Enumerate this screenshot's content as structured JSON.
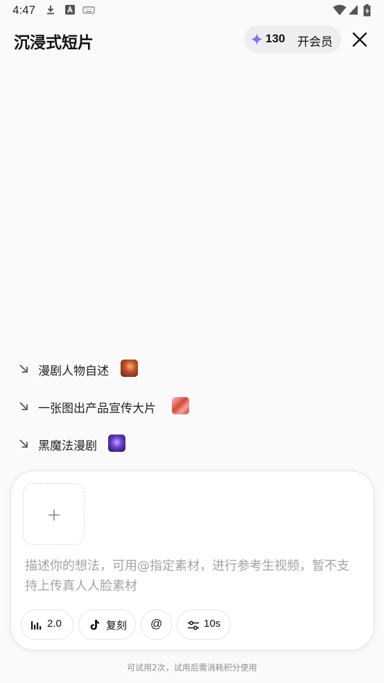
{
  "status_bar": {
    "time": "4:47"
  },
  "header": {
    "title": "沉浸式短片",
    "credits": "130",
    "member_label": "开会员",
    "accent_color": "#8b6cf6"
  },
  "suggestions": [
    {
      "label": "漫剧人物自述",
      "icon": "arrow-down-right-icon"
    },
    {
      "label": "一张图出产品宣传大片",
      "icon": "arrow-down-right-icon"
    },
    {
      "label": "黑魔法漫剧",
      "icon": "arrow-down-right-icon"
    }
  ],
  "composer": {
    "placeholder": "描述你的想法，可用@指定素材，进行参考生视频，暂不支持上传真人人脸素材",
    "chips": [
      {
        "label": "2.0",
        "icon": "bar-chart-icon"
      },
      {
        "label": "复刻",
        "icon": "tiktok-icon"
      },
      {
        "label": "@",
        "icon": ""
      },
      {
        "label": "10s",
        "icon": "sliders-icon"
      }
    ]
  },
  "footer_note": "可试用2次，试用后需消耗积分使用"
}
